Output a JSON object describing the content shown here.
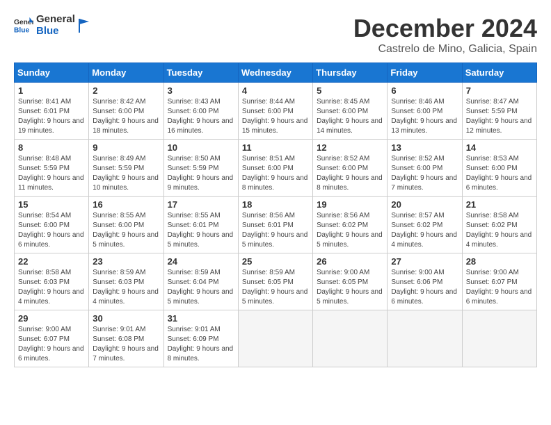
{
  "header": {
    "logo_general": "General",
    "logo_blue": "Blue",
    "month_title": "December 2024",
    "location": "Castrelo de Mino, Galicia, Spain"
  },
  "weekdays": [
    "Sunday",
    "Monday",
    "Tuesday",
    "Wednesday",
    "Thursday",
    "Friday",
    "Saturday"
  ],
  "weeks": [
    [
      {
        "day": "1",
        "sunrise": "8:41 AM",
        "sunset": "6:01 PM",
        "daylight": "9 hours and 19 minutes."
      },
      {
        "day": "2",
        "sunrise": "8:42 AM",
        "sunset": "6:00 PM",
        "daylight": "9 hours and 18 minutes."
      },
      {
        "day": "3",
        "sunrise": "8:43 AM",
        "sunset": "6:00 PM",
        "daylight": "9 hours and 16 minutes."
      },
      {
        "day": "4",
        "sunrise": "8:44 AM",
        "sunset": "6:00 PM",
        "daylight": "9 hours and 15 minutes."
      },
      {
        "day": "5",
        "sunrise": "8:45 AM",
        "sunset": "6:00 PM",
        "daylight": "9 hours and 14 minutes."
      },
      {
        "day": "6",
        "sunrise": "8:46 AM",
        "sunset": "6:00 PM",
        "daylight": "9 hours and 13 minutes."
      },
      {
        "day": "7",
        "sunrise": "8:47 AM",
        "sunset": "5:59 PM",
        "daylight": "9 hours and 12 minutes."
      }
    ],
    [
      {
        "day": "8",
        "sunrise": "8:48 AM",
        "sunset": "5:59 PM",
        "daylight": "9 hours and 11 minutes."
      },
      {
        "day": "9",
        "sunrise": "8:49 AM",
        "sunset": "5:59 PM",
        "daylight": "9 hours and 10 minutes."
      },
      {
        "day": "10",
        "sunrise": "8:50 AM",
        "sunset": "5:59 PM",
        "daylight": "9 hours and 9 minutes."
      },
      {
        "day": "11",
        "sunrise": "8:51 AM",
        "sunset": "6:00 PM",
        "daylight": "9 hours and 8 minutes."
      },
      {
        "day": "12",
        "sunrise": "8:52 AM",
        "sunset": "6:00 PM",
        "daylight": "9 hours and 8 minutes."
      },
      {
        "day": "13",
        "sunrise": "8:52 AM",
        "sunset": "6:00 PM",
        "daylight": "9 hours and 7 minutes."
      },
      {
        "day": "14",
        "sunrise": "8:53 AM",
        "sunset": "6:00 PM",
        "daylight": "9 hours and 6 minutes."
      }
    ],
    [
      {
        "day": "15",
        "sunrise": "8:54 AM",
        "sunset": "6:00 PM",
        "daylight": "9 hours and 6 minutes."
      },
      {
        "day": "16",
        "sunrise": "8:55 AM",
        "sunset": "6:00 PM",
        "daylight": "9 hours and 5 minutes."
      },
      {
        "day": "17",
        "sunrise": "8:55 AM",
        "sunset": "6:01 PM",
        "daylight": "9 hours and 5 minutes."
      },
      {
        "day": "18",
        "sunrise": "8:56 AM",
        "sunset": "6:01 PM",
        "daylight": "9 hours and 5 minutes."
      },
      {
        "day": "19",
        "sunrise": "8:56 AM",
        "sunset": "6:02 PM",
        "daylight": "9 hours and 5 minutes."
      },
      {
        "day": "20",
        "sunrise": "8:57 AM",
        "sunset": "6:02 PM",
        "daylight": "9 hours and 4 minutes."
      },
      {
        "day": "21",
        "sunrise": "8:58 AM",
        "sunset": "6:02 PM",
        "daylight": "9 hours and 4 minutes."
      }
    ],
    [
      {
        "day": "22",
        "sunrise": "8:58 AM",
        "sunset": "6:03 PM",
        "daylight": "9 hours and 4 minutes."
      },
      {
        "day": "23",
        "sunrise": "8:59 AM",
        "sunset": "6:03 PM",
        "daylight": "9 hours and 4 minutes."
      },
      {
        "day": "24",
        "sunrise": "8:59 AM",
        "sunset": "6:04 PM",
        "daylight": "9 hours and 5 minutes."
      },
      {
        "day": "25",
        "sunrise": "8:59 AM",
        "sunset": "6:05 PM",
        "daylight": "9 hours and 5 minutes."
      },
      {
        "day": "26",
        "sunrise": "9:00 AM",
        "sunset": "6:05 PM",
        "daylight": "9 hours and 5 minutes."
      },
      {
        "day": "27",
        "sunrise": "9:00 AM",
        "sunset": "6:06 PM",
        "daylight": "9 hours and 6 minutes."
      },
      {
        "day": "28",
        "sunrise": "9:00 AM",
        "sunset": "6:07 PM",
        "daylight": "9 hours and 6 minutes."
      }
    ],
    [
      {
        "day": "29",
        "sunrise": "9:00 AM",
        "sunset": "6:07 PM",
        "daylight": "9 hours and 6 minutes."
      },
      {
        "day": "30",
        "sunrise": "9:01 AM",
        "sunset": "6:08 PM",
        "daylight": "9 hours and 7 minutes."
      },
      {
        "day": "31",
        "sunrise": "9:01 AM",
        "sunset": "6:09 PM",
        "daylight": "9 hours and 8 minutes."
      },
      null,
      null,
      null,
      null
    ]
  ]
}
